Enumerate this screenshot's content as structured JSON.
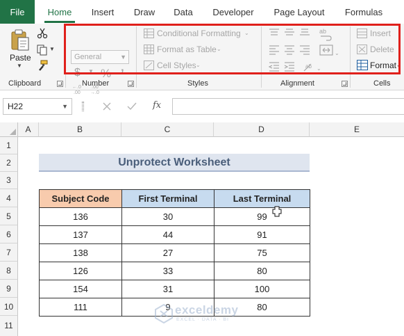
{
  "tabs": [
    "File",
    "Home",
    "Insert",
    "Draw",
    "Data",
    "Developer",
    "Page Layout",
    "Formulas"
  ],
  "ribbon": {
    "clipboard": {
      "paste_label": "Paste",
      "group_label": "Clipboard"
    },
    "number": {
      "format_value": "General",
      "currency_symbol": "$",
      "percent_symbol": "%",
      "comma_symbol": "’",
      "inc_decimal": "←.0\n.00",
      "dec_decimal": ".00\n→.0",
      "group_label": "Number"
    },
    "styles": {
      "conditional": "Conditional Formatting",
      "table": "Format as Table",
      "cell_styles": "Cell Styles",
      "group_label": "Styles"
    },
    "alignment": {
      "group_label": "Alignment"
    },
    "cells": {
      "insert": "Insert",
      "delete": "Delete",
      "format": "Format",
      "group_label": "Cells"
    }
  },
  "formula_bar": {
    "name_box": "H22",
    "fx": "fx"
  },
  "columns": [
    "A",
    "B",
    "C",
    "D",
    "E"
  ],
  "rows": [
    "1",
    "2",
    "3",
    "4",
    "5",
    "6",
    "7",
    "8",
    "9",
    "10",
    "11"
  ],
  "sheet": {
    "title": "Unprotect Worksheet",
    "headers": [
      "Subject Code",
      "First Terminal",
      "Last Terminal"
    ],
    "data": [
      [
        "136",
        "30",
        "99"
      ],
      [
        "137",
        "44",
        "91"
      ],
      [
        "138",
        "27",
        "75"
      ],
      [
        "126",
        "33",
        "80"
      ],
      [
        "154",
        "31",
        "100"
      ],
      [
        "111",
        "9",
        "80"
      ]
    ]
  },
  "watermark": {
    "name": "exceldemy",
    "tagline": "EXCEL · DATA · BI"
  },
  "colors": {
    "file_tab": "#217346",
    "highlight_border": "#e0201b",
    "subject_header": "#f8cbad",
    "terminal_header": "#c7dbef",
    "title_fill": "#dfe5ef"
  }
}
